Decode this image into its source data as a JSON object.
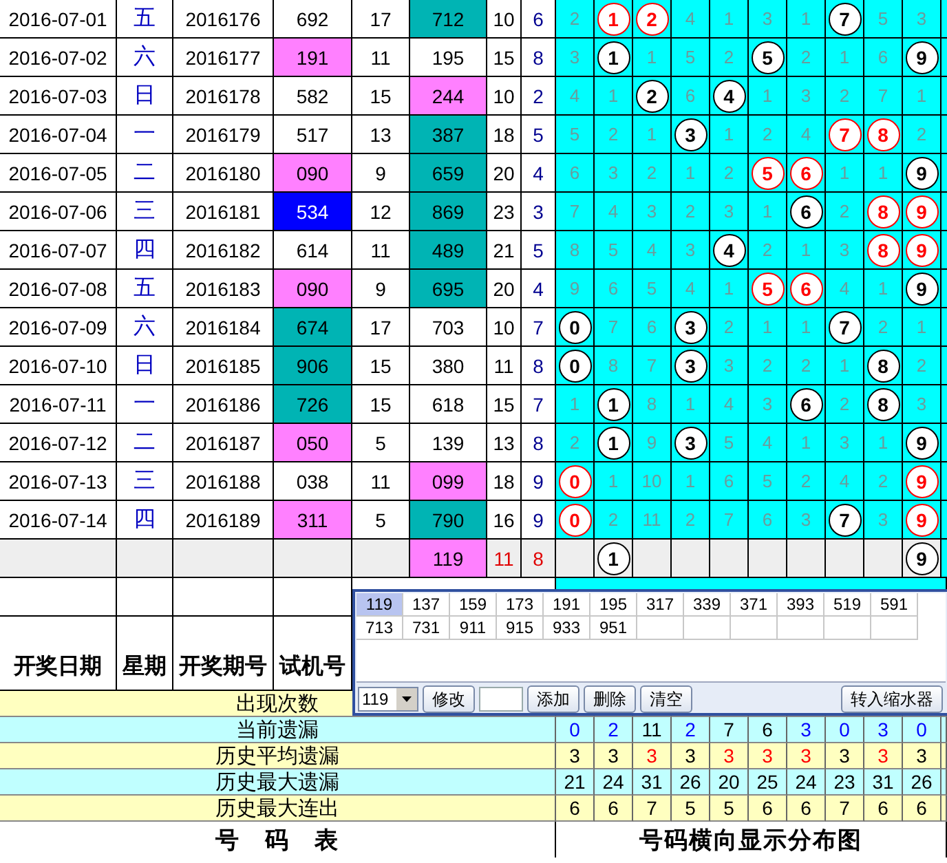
{
  "rows": [
    {
      "date": "2016-07-01",
      "weekday": "五",
      "issue": "2016176",
      "trial": {
        "text": "692"
      },
      "column_5": "17",
      "column_6": {
        "text": "712",
        "color": "#00b4b4"
      },
      "column_7": "10",
      "column_8": "6",
      "distribution": [
        {
          "kind": "miss",
          "text": "2"
        },
        {
          "kind": "ball",
          "text": "1",
          "color": "#ff0000"
        },
        {
          "kind": "ball",
          "text": "2",
          "color": "#ff0000"
        },
        {
          "kind": "miss",
          "text": "4"
        },
        {
          "kind": "miss",
          "text": "1"
        },
        {
          "kind": "miss",
          "text": "3"
        },
        {
          "kind": "miss",
          "text": "1"
        },
        {
          "kind": "ball",
          "text": "7",
          "color": "#000000"
        },
        {
          "kind": "miss",
          "text": "5"
        },
        {
          "kind": "miss",
          "text": "3"
        }
      ]
    },
    {
      "date": "2016-07-02",
      "weekday": "六",
      "issue": "2016177",
      "trial": {
        "text": "191",
        "color": "#ff80ff"
      },
      "column_5": "11",
      "column_6": {
        "text": "195"
      },
      "column_7": "15",
      "column_8": "8",
      "distribution": [
        {
          "kind": "miss",
          "text": "3"
        },
        {
          "kind": "ball",
          "text": "1",
          "color": "#000000"
        },
        {
          "kind": "miss",
          "text": "1"
        },
        {
          "kind": "miss",
          "text": "5"
        },
        {
          "kind": "miss",
          "text": "2"
        },
        {
          "kind": "ball",
          "text": "5",
          "color": "#000000"
        },
        {
          "kind": "miss",
          "text": "2"
        },
        {
          "kind": "miss",
          "text": "1"
        },
        {
          "kind": "miss",
          "text": "6"
        },
        {
          "kind": "ball",
          "text": "9",
          "color": "#000000"
        }
      ]
    },
    {
      "date": "2016-07-03",
      "weekday": "日",
      "issue": "2016178",
      "trial": {
        "text": "582"
      },
      "column_5": "15",
      "column_6": {
        "text": "244",
        "color": "#ff80ff"
      },
      "column_7": "10",
      "column_8": "2",
      "distribution": [
        {
          "kind": "miss",
          "text": "4"
        },
        {
          "kind": "miss",
          "text": "1"
        },
        {
          "kind": "ball",
          "text": "2",
          "color": "#000000"
        },
        {
          "kind": "miss",
          "text": "6"
        },
        {
          "kind": "ball",
          "text": "4",
          "color": "#000000"
        },
        {
          "kind": "miss",
          "text": "1"
        },
        {
          "kind": "miss",
          "text": "3"
        },
        {
          "kind": "miss",
          "text": "2"
        },
        {
          "kind": "miss",
          "text": "7"
        },
        {
          "kind": "miss",
          "text": "1"
        }
      ]
    },
    {
      "date": "2016-07-04",
      "weekday": "一",
      "issue": "2016179",
      "trial": {
        "text": "517"
      },
      "column_5": "13",
      "column_6": {
        "text": "387",
        "color": "#00b4b4"
      },
      "column_7": "18",
      "column_8": "5",
      "distribution": [
        {
          "kind": "miss",
          "text": "5"
        },
        {
          "kind": "miss",
          "text": "2"
        },
        {
          "kind": "miss",
          "text": "1"
        },
        {
          "kind": "ball",
          "text": "3",
          "color": "#000000"
        },
        {
          "kind": "miss",
          "text": "1"
        },
        {
          "kind": "miss",
          "text": "2"
        },
        {
          "kind": "miss",
          "text": "4"
        },
        {
          "kind": "ball",
          "text": "7",
          "color": "#ff0000"
        },
        {
          "kind": "ball",
          "text": "8",
          "color": "#ff0000"
        },
        {
          "kind": "miss",
          "text": "2"
        }
      ]
    },
    {
      "date": "2016-07-05",
      "weekday": "二",
      "issue": "2016180",
      "trial": {
        "text": "090",
        "color": "#ff80ff"
      },
      "column_5": "9",
      "column_6": {
        "text": "659",
        "color": "#00b4b4"
      },
      "column_7": "20",
      "column_8": "4",
      "distribution": [
        {
          "kind": "miss",
          "text": "6"
        },
        {
          "kind": "miss",
          "text": "3"
        },
        {
          "kind": "miss",
          "text": "2"
        },
        {
          "kind": "miss",
          "text": "1"
        },
        {
          "kind": "miss",
          "text": "2"
        },
        {
          "kind": "ball",
          "text": "5",
          "color": "#ff0000"
        },
        {
          "kind": "ball",
          "text": "6",
          "color": "#ff0000"
        },
        {
          "kind": "miss",
          "text": "1"
        },
        {
          "kind": "miss",
          "text": "1"
        },
        {
          "kind": "ball",
          "text": "9",
          "color": "#000000"
        }
      ]
    },
    {
      "date": "2016-07-06",
      "weekday": "三",
      "issue": "2016181",
      "trial": {
        "text": "534",
        "color": "#0000ff"
      },
      "column_5": "12",
      "column_6": {
        "text": "869",
        "color": "#00b4b4"
      },
      "column_7": "23",
      "column_8": "3",
      "distribution": [
        {
          "kind": "miss",
          "text": "7"
        },
        {
          "kind": "miss",
          "text": "4"
        },
        {
          "kind": "miss",
          "text": "3"
        },
        {
          "kind": "miss",
          "text": "2"
        },
        {
          "kind": "miss",
          "text": "3"
        },
        {
          "kind": "miss",
          "text": "1"
        },
        {
          "kind": "ball",
          "text": "6",
          "color": "#000000"
        },
        {
          "kind": "miss",
          "text": "2"
        },
        {
          "kind": "ball",
          "text": "8",
          "color": "#ff0000"
        },
        {
          "kind": "ball",
          "text": "9",
          "color": "#ff0000"
        }
      ]
    },
    {
      "date": "2016-07-07",
      "weekday": "四",
      "issue": "2016182",
      "trial": {
        "text": "614"
      },
      "column_5": "11",
      "column_6": {
        "text": "489",
        "color": "#00b4b4"
      },
      "column_7": "21",
      "column_8": "5",
      "distribution": [
        {
          "kind": "miss",
          "text": "8"
        },
        {
          "kind": "miss",
          "text": "5"
        },
        {
          "kind": "miss",
          "text": "4"
        },
        {
          "kind": "miss",
          "text": "3"
        },
        {
          "kind": "ball",
          "text": "4",
          "color": "#000000"
        },
        {
          "kind": "miss",
          "text": "2"
        },
        {
          "kind": "miss",
          "text": "1"
        },
        {
          "kind": "miss",
          "text": "3"
        },
        {
          "kind": "ball",
          "text": "8",
          "color": "#ff0000"
        },
        {
          "kind": "ball",
          "text": "9",
          "color": "#ff0000"
        }
      ]
    },
    {
      "date": "2016-07-08",
      "weekday": "五",
      "issue": "2016183",
      "trial": {
        "text": "090",
        "color": "#ff80ff"
      },
      "column_5": "9",
      "column_6": {
        "text": "695",
        "color": "#00b4b4"
      },
      "column_7": "20",
      "column_8": "4",
      "distribution": [
        {
          "kind": "miss",
          "text": "9"
        },
        {
          "kind": "miss",
          "text": "6"
        },
        {
          "kind": "miss",
          "text": "5"
        },
        {
          "kind": "miss",
          "text": "4"
        },
        {
          "kind": "miss",
          "text": "1"
        },
        {
          "kind": "ball",
          "text": "5",
          "color": "#ff0000"
        },
        {
          "kind": "ball",
          "text": "6",
          "color": "#ff0000"
        },
        {
          "kind": "miss",
          "text": "4"
        },
        {
          "kind": "miss",
          "text": "1"
        },
        {
          "kind": "ball",
          "text": "9",
          "color": "#000000"
        }
      ]
    },
    {
      "date": "2016-07-09",
      "weekday": "六",
      "issue": "2016184",
      "trial": {
        "text": "674",
        "color": "#00b4b4"
      },
      "column_5": "17",
      "column_6": {
        "text": "703"
      },
      "column_7": "10",
      "column_8": "7",
      "distribution": [
        {
          "kind": "ball",
          "text": "0",
          "color": "#000000"
        },
        {
          "kind": "miss",
          "text": "7"
        },
        {
          "kind": "miss",
          "text": "6"
        },
        {
          "kind": "ball",
          "text": "3",
          "color": "#000000"
        },
        {
          "kind": "miss",
          "text": "2"
        },
        {
          "kind": "miss",
          "text": "1"
        },
        {
          "kind": "miss",
          "text": "1"
        },
        {
          "kind": "ball",
          "text": "7",
          "color": "#000000"
        },
        {
          "kind": "miss",
          "text": "2"
        },
        {
          "kind": "miss",
          "text": "1"
        }
      ]
    },
    {
      "date": "2016-07-10",
      "weekday": "日",
      "issue": "2016185",
      "trial": {
        "text": "906",
        "color": "#00b4b4"
      },
      "column_5": "15",
      "column_6": {
        "text": "380"
      },
      "column_7": "11",
      "column_8": "8",
      "distribution": [
        {
          "kind": "ball",
          "text": "0",
          "color": "#000000"
        },
        {
          "kind": "miss",
          "text": "8"
        },
        {
          "kind": "miss",
          "text": "7"
        },
        {
          "kind": "ball",
          "text": "3",
          "color": "#000000"
        },
        {
          "kind": "miss",
          "text": "3"
        },
        {
          "kind": "miss",
          "text": "2"
        },
        {
          "kind": "miss",
          "text": "2"
        },
        {
          "kind": "miss",
          "text": "1"
        },
        {
          "kind": "ball",
          "text": "8",
          "color": "#000000"
        },
        {
          "kind": "miss",
          "text": "2"
        }
      ]
    },
    {
      "date": "2016-07-11",
      "weekday": "一",
      "issue": "2016186",
      "trial": {
        "text": "726",
        "color": "#00b4b4"
      },
      "column_5": "15",
      "column_6": {
        "text": "618"
      },
      "column_7": "15",
      "column_8": "7",
      "distribution": [
        {
          "kind": "miss",
          "text": "1"
        },
        {
          "kind": "ball",
          "text": "1",
          "color": "#000000"
        },
        {
          "kind": "miss",
          "text": "8"
        },
        {
          "kind": "miss",
          "text": "1"
        },
        {
          "kind": "miss",
          "text": "4"
        },
        {
          "kind": "miss",
          "text": "3"
        },
        {
          "kind": "ball",
          "text": "6",
          "color": "#000000"
        },
        {
          "kind": "miss",
          "text": "2"
        },
        {
          "kind": "ball",
          "text": "8",
          "color": "#000000"
        },
        {
          "kind": "miss",
          "text": "3"
        }
      ]
    },
    {
      "date": "2016-07-12",
      "weekday": "二",
      "issue": "2016187",
      "trial": {
        "text": "050",
        "color": "#ff80ff"
      },
      "column_5": "5",
      "column_6": {
        "text": "139"
      },
      "column_7": "13",
      "column_8": "8",
      "distribution": [
        {
          "kind": "miss",
          "text": "2"
        },
        {
          "kind": "ball",
          "text": "1",
          "color": "#000000"
        },
        {
          "kind": "miss",
          "text": "9"
        },
        {
          "kind": "ball",
          "text": "3",
          "color": "#000000"
        },
        {
          "kind": "miss",
          "text": "5"
        },
        {
          "kind": "miss",
          "text": "4"
        },
        {
          "kind": "miss",
          "text": "1"
        },
        {
          "kind": "miss",
          "text": "3"
        },
        {
          "kind": "miss",
          "text": "1"
        },
        {
          "kind": "ball",
          "text": "9",
          "color": "#000000"
        }
      ]
    },
    {
      "date": "2016-07-13",
      "weekday": "三",
      "issue": "2016188",
      "trial": {
        "text": "038"
      },
      "column_5": "11",
      "column_6": {
        "text": "099",
        "color": "#ff80ff"
      },
      "column_7": "18",
      "column_8": "9",
      "distribution": [
        {
          "kind": "ball",
          "text": "0",
          "color": "#ff0000"
        },
        {
          "kind": "miss",
          "text": "1"
        },
        {
          "kind": "miss",
          "text": "10"
        },
        {
          "kind": "miss",
          "text": "1"
        },
        {
          "kind": "miss",
          "text": "6"
        },
        {
          "kind": "miss",
          "text": "5"
        },
        {
          "kind": "miss",
          "text": "2"
        },
        {
          "kind": "miss",
          "text": "4"
        },
        {
          "kind": "miss",
          "text": "2"
        },
        {
          "kind": "ball",
          "text": "9",
          "color": "#ff0000"
        }
      ]
    },
    {
      "date": "2016-07-14",
      "weekday": "四",
      "issue": "2016189",
      "trial": {
        "text": "311",
        "color": "#ff80ff"
      },
      "column_5": "5",
      "column_6": {
        "text": "790",
        "color": "#00b4b4"
      },
      "column_7": "16",
      "column_8": "9",
      "distribution": [
        {
          "kind": "ball",
          "text": "0",
          "color": "#ff0000"
        },
        {
          "kind": "miss",
          "text": "2"
        },
        {
          "kind": "miss",
          "text": "11"
        },
        {
          "kind": "miss",
          "text": "2"
        },
        {
          "kind": "miss",
          "text": "7"
        },
        {
          "kind": "miss",
          "text": "6"
        },
        {
          "kind": "miss",
          "text": "3"
        },
        {
          "kind": "ball",
          "text": "7",
          "color": "#000000"
        },
        {
          "kind": "miss",
          "text": "3"
        },
        {
          "kind": "ball",
          "text": "9",
          "color": "#ff0000"
        }
      ]
    }
  ],
  "summary_row": {
    "column_6": {
      "text": "119",
      "color": "#ff80ff"
    },
    "column_7": "11",
    "column_8": "8",
    "distribution": [
      {
        "kind": "empty"
      },
      {
        "kind": "ball",
        "text": "1",
        "color": "#000000"
      },
      {
        "kind": "empty"
      },
      {
        "kind": "empty"
      },
      {
        "kind": "empty"
      },
      {
        "kind": "empty"
      },
      {
        "kind": "empty"
      },
      {
        "kind": "empty"
      },
      {
        "kind": "empty"
      },
      {
        "kind": "ball",
        "text": "9",
        "color": "#000000"
      }
    ]
  },
  "header": [
    "开奖日期",
    "星期",
    "开奖期号",
    "试机号"
  ],
  "stats": [
    {
      "label": "出现次数"
    },
    {
      "label": "当前遗漏",
      "values": [
        {
          "text": "0",
          "color": "#0000ff"
        },
        {
          "text": "2",
          "color": "#0000ff"
        },
        {
          "text": "11",
          "color": "#000000"
        },
        {
          "text": "2",
          "color": "#0000ff"
        },
        {
          "text": "7",
          "color": "#000000"
        },
        {
          "text": "6",
          "color": "#000000"
        },
        {
          "text": "3",
          "color": "#0000ff"
        },
        {
          "text": "0",
          "color": "#0000ff"
        },
        {
          "text": "3",
          "color": "#0000ff"
        },
        {
          "text": "0",
          "color": "#0000ff"
        }
      ]
    },
    {
      "label": "历史平均遗漏",
      "values": [
        {
          "text": "3",
          "color": "#000000"
        },
        {
          "text": "3",
          "color": "#000000"
        },
        {
          "text": "3",
          "color": "#ff0000"
        },
        {
          "text": "3",
          "color": "#000000"
        },
        {
          "text": "3",
          "color": "#ff0000"
        },
        {
          "text": "3",
          "color": "#ff0000"
        },
        {
          "text": "3",
          "color": "#ff0000"
        },
        {
          "text": "3",
          "color": "#000000"
        },
        {
          "text": "3",
          "color": "#ff0000"
        },
        {
          "text": "3",
          "color": "#000000"
        }
      ]
    },
    {
      "label": "历史最大遗漏",
      "values": [
        {
          "text": "21",
          "color": "#000000"
        },
        {
          "text": "24",
          "color": "#000000"
        },
        {
          "text": "31",
          "color": "#000000"
        },
        {
          "text": "26",
          "color": "#000000"
        },
        {
          "text": "20",
          "color": "#000000"
        },
        {
          "text": "25",
          "color": "#000000"
        },
        {
          "text": "24",
          "color": "#000000"
        },
        {
          "text": "23",
          "color": "#000000"
        },
        {
          "text": "31",
          "color": "#000000"
        },
        {
          "text": "26",
          "color": "#000000"
        }
      ]
    },
    {
      "label": "历史最大连出",
      "values": [
        {
          "text": "6",
          "color": "#000000"
        },
        {
          "text": "6",
          "color": "#000000"
        },
        {
          "text": "7",
          "color": "#000000"
        },
        {
          "text": "5",
          "color": "#000000"
        },
        {
          "text": "5",
          "color": "#000000"
        },
        {
          "text": "6",
          "color": "#000000"
        },
        {
          "text": "6",
          "color": "#000000"
        },
        {
          "text": "7",
          "color": "#000000"
        },
        {
          "text": "6",
          "color": "#000000"
        },
        {
          "text": "6",
          "color": "#000000"
        }
      ]
    }
  ],
  "footer": [
    "号　码　表",
    "号码横向显示分布图"
  ],
  "popup": {
    "numbers": [
      {
        "text": "119",
        "selected": true
      },
      {
        "text": "137",
        "selected": false
      },
      {
        "text": "159",
        "selected": false
      },
      {
        "text": "173",
        "selected": false
      },
      {
        "text": "191",
        "selected": false
      },
      {
        "text": "195",
        "selected": false
      },
      {
        "text": "317",
        "selected": false
      },
      {
        "text": "339",
        "selected": false
      },
      {
        "text": "371",
        "selected": false
      },
      {
        "text": "393",
        "selected": false
      },
      {
        "text": "519",
        "selected": false
      },
      {
        "text": "591",
        "selected": false
      },
      {
        "text": "713",
        "selected": false
      },
      {
        "text": "731",
        "selected": false
      },
      {
        "text": "911",
        "selected": false
      },
      {
        "text": "915",
        "selected": false
      },
      {
        "text": "933",
        "selected": false
      },
      {
        "text": "951",
        "selected": false
      }
    ],
    "dropdown": {
      "value": "119"
    },
    "edit_button": "修改",
    "buttons": [
      "添加",
      "删除",
      "清空"
    ],
    "transfer_button": "转入缩水器"
  }
}
